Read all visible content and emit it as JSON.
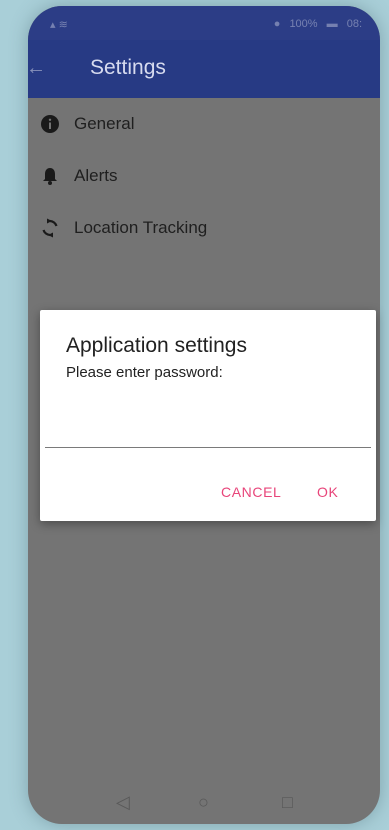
{
  "status_bar": {
    "battery_text": "100%",
    "time": "08:"
  },
  "app_bar": {
    "title": "Settings"
  },
  "menu": [
    {
      "label": "General",
      "icon": "info-icon"
    },
    {
      "label": "Alerts",
      "icon": "bell-icon"
    },
    {
      "label": "Location Tracking",
      "icon": "sync-icon"
    }
  ],
  "dialog": {
    "title": "Application settings",
    "message": "Please enter password:",
    "input_value": "",
    "cancel_label": "CANCEL",
    "ok_label": "OK"
  },
  "colors": {
    "app_bar": "#273a84",
    "accent": "#e8457a",
    "scrim": "#747474"
  }
}
